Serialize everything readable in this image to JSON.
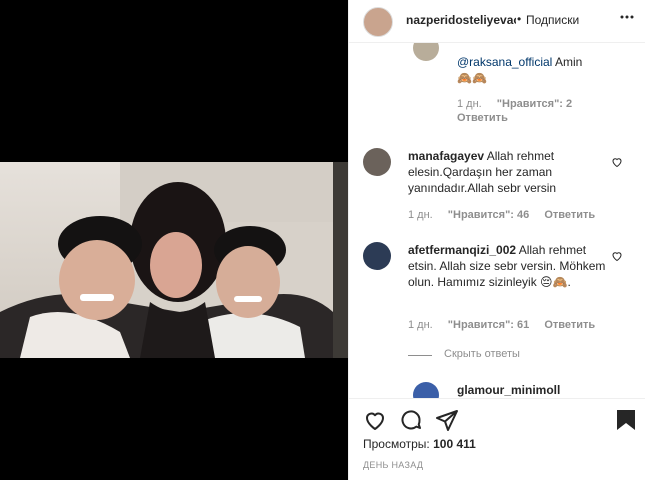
{
  "header": {
    "username": "nazperidosteliyevaoffi",
    "follow_label": "Подписки",
    "separator": "•",
    "more_label": "···"
  },
  "comments": [
    {
      "mention": "@raksana_official",
      "text": " Amin",
      "emoji": "🙈🙈",
      "time": "1 дн.",
      "likes": "\"Нравится\": 2",
      "reply": "Ответить"
    },
    {
      "username": "manafagayev",
      "text": "Allah rehmet elesin.Qardaşın her zaman yanındadır.Allah sebr versin",
      "time": "1 дн.",
      "likes": "\"Нравится\": 46",
      "reply": "Ответить"
    },
    {
      "username": "afetfermanqizi_002",
      "text": "Allah rehmet etsin. Allah size sebr versin. Möhkem olun. Hamımız sizinleyik",
      "emoji": "😔🙈.",
      "time": "1 дн.",
      "likes": "\"Нравится\": 61",
      "reply": "Ответить"
    },
    {
      "username": "glamour_minimoll"
    }
  ],
  "hide_replies_label": "Скрыть ответы",
  "footer": {
    "views_label": "Просмотры:",
    "views_count": "100 411",
    "time_label": "ДЕНЬ НАЗАД"
  },
  "colors": {
    "mention": "#00376b",
    "secondary_text": "#8e8e8e",
    "primary_text": "#262626"
  }
}
